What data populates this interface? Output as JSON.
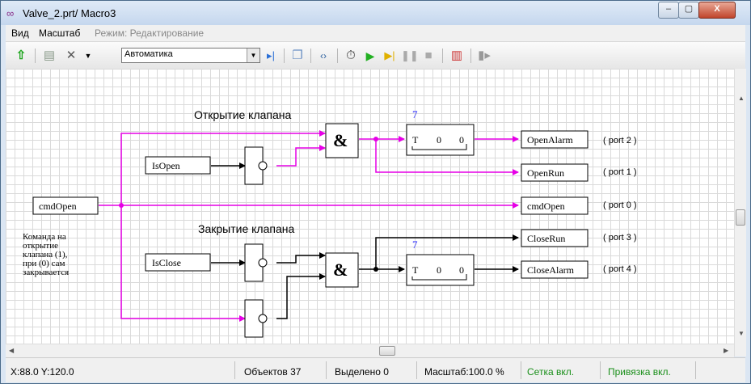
{
  "window": {
    "title": "Valve_2.prt/ Macro3",
    "controls": {
      "minimize": "–",
      "maximize": "▢",
      "close": "X"
    }
  },
  "menu": {
    "items": [
      "Вид",
      "Масштаб"
    ],
    "mode_label": "Режим: Редактирование"
  },
  "toolbar": {
    "combo_value": "Автоматика",
    "icons": [
      "up-arrow-icon",
      "document-icon",
      "tools-icon",
      "dropdown-arrow-icon",
      "step-icon",
      "layers-icon",
      "link-icon",
      "stopwatch-icon",
      "play-icon",
      "step-forward-icon",
      "pause-icon",
      "stop-icon",
      "bar-chart-icon",
      "exit-icon"
    ]
  },
  "diagram": {
    "section_open_label": "Открытие клапана",
    "section_close_label": "Закрытие клапана",
    "comment": [
      "Команда на",
      "открытие",
      "клапана (1),",
      "при (0) сам",
      "закрывается"
    ],
    "inputs": {
      "cmd": "cmdOpen",
      "is_open": "IsOpen",
      "is_close": "IsClose"
    },
    "and_symbol": "&",
    "timer_open": {
      "number": "7",
      "t": "T",
      "v1": "0",
      "v2": "0"
    },
    "timer_close": {
      "number": "7",
      "t": "T",
      "v1": "0",
      "v2": "0"
    },
    "outputs": [
      {
        "name": "OpenAlarm",
        "port": "( port 2 )"
      },
      {
        "name": "OpenRun",
        "port": "( port 1 )"
      },
      {
        "name": "cmdOpen",
        "port": "( port 0 )"
      },
      {
        "name": "CloseRun",
        "port": "( port 3 )"
      },
      {
        "name": "CloseAlarm",
        "port": "( port 4 )"
      }
    ],
    "colors": {
      "signal_on": "#e600e6",
      "signal_off": "#000000",
      "timer_number": "#2a2aff"
    }
  },
  "status": {
    "coords": "X:88.0  Y:120.0",
    "objects": "Объектов 37",
    "selected": "Выделено 0",
    "scale": "Масштаб:100.0 %",
    "grid": "Сетка вкл.",
    "snap": "Привязка вкл."
  }
}
